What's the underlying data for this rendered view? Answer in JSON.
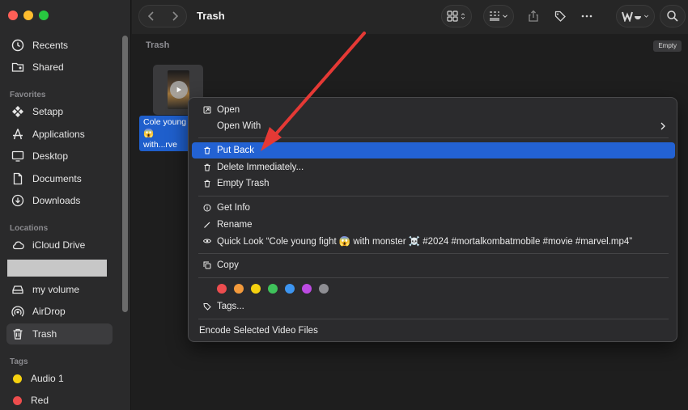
{
  "window": {
    "title": "Trash"
  },
  "sidebar": {
    "sections": {
      "favorites": "Favorites",
      "locations": "Locations",
      "tags": "Tags"
    },
    "top_items": [
      {
        "label": "Recents",
        "icon": "clock-icon"
      },
      {
        "label": "Shared",
        "icon": "shared-folder-icon"
      }
    ],
    "favorites": [
      {
        "label": "Setapp",
        "icon": "setapp-icon"
      },
      {
        "label": "Applications",
        "icon": "applications-icon"
      },
      {
        "label": "Desktop",
        "icon": "desktop-icon"
      },
      {
        "label": "Documents",
        "icon": "document-icon"
      },
      {
        "label": "Downloads",
        "icon": "download-icon"
      }
    ],
    "locations": [
      {
        "label": "iCloud Drive",
        "icon": "cloud-icon"
      },
      {
        "label": "my volume",
        "icon": "drive-icon"
      },
      {
        "label": "AirDrop",
        "icon": "airdrop-icon"
      },
      {
        "label": "Trash",
        "icon": "trash-icon",
        "active": true
      }
    ],
    "tags": [
      {
        "label": "Audio 1",
        "color": "#f5d10f"
      },
      {
        "label": "Red",
        "color": "#ee4d4d"
      }
    ]
  },
  "content": {
    "path_label": "Trash",
    "empty_button": "Empty",
    "file": {
      "label_line1": "Cole young",
      "label_line2": "😱 with...rve"
    }
  },
  "context_menu": {
    "open": "Open",
    "open_with": "Open With",
    "put_back": "Put Back",
    "delete_immediately": "Delete Immediately...",
    "empty_trash": "Empty Trash",
    "get_info": "Get Info",
    "rename": "Rename",
    "quick_look": "Quick Look “Cole young fight 😱 with monster ☠️ #2024 #mortalkombatmobile #movie #marvel.mp4”",
    "copy": "Copy",
    "tags": "Tags...",
    "encode": "Encode Selected Video Files",
    "tag_colors": [
      "#ed4d4f",
      "#f39a3c",
      "#f5d10f",
      "#3fc25b",
      "#3d95f0",
      "#bd4be3",
      "#8e8e93"
    ]
  },
  "colors": {
    "accent": "#2362d3",
    "annotation_arrow": "#e53935"
  }
}
